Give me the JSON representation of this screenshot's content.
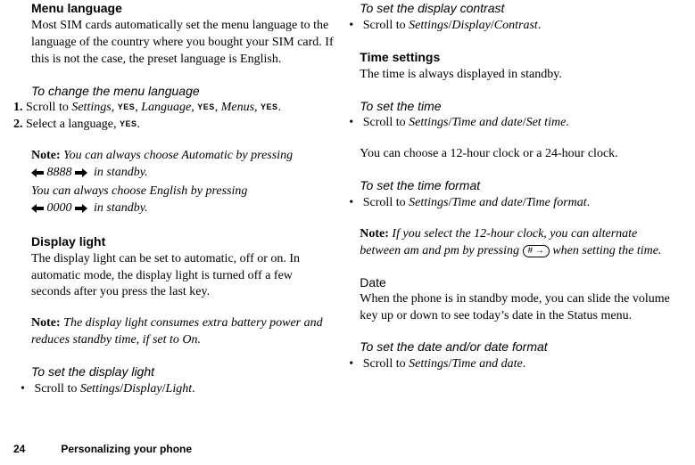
{
  "left": {
    "h_menu_language": "Menu language",
    "p_menu_language": "Most SIM cards automatically set the menu language to the language of the country where you bought your SIM card. If this is not the case, the preset language is English.",
    "h_change_menu_lang": "To change the menu language",
    "steps": {
      "s1_a": "Scroll to ",
      "s1_settings": "Settings",
      "s1_c1": ", ",
      "s1_c2": ", ",
      "s1_language": "Language",
      "s1_c3": ", ",
      "s1_c4": ", ",
      "s1_menus": "Menus",
      "s1_c5": ", ",
      "s1_end": ".",
      "s2_a": "Select a language, ",
      "s2_end": "."
    },
    "yes_label": "YES",
    "note_label": "Note:",
    "note1_a": "You can always choose Automatic by pressing",
    "note1_code": "8888",
    "note1_b": "in standby.",
    "note1_c": "You can always choose English by pressing",
    "note1_code2": "0000",
    "note1_d": "in standby.",
    "h_display_light": "Display light",
    "p_display_light": "The display light can be set to automatic, off or on. In automatic mode, the display light is turned off a few seconds after you press the last key.",
    "note2": "The display light consumes extra battery power and reduces standby time, if set to On.",
    "h_set_display_light": "To set the display light",
    "bul_sdl_a": "Scroll to ",
    "bul_sdl_path1": "Settings",
    "bul_sdl_sep": "/",
    "bul_sdl_path2": "Display",
    "bul_sdl_path3": "Light",
    "bul_sdl_end": "."
  },
  "right": {
    "h_set_display_contrast": "To set the display contrast",
    "bul_sdc_a": "Scroll to ",
    "bul_sdc_p1": "Settings",
    "sep": "/",
    "bul_sdc_p2": "Display",
    "bul_sdc_p3": "Contrast",
    "end": ".",
    "h_time_settings": "Time settings",
    "p_time_settings": "The time is always displayed in standby.",
    "h_set_time": "To set the time",
    "bul_st_a": "Scroll to ",
    "bul_st_p1": "Settings",
    "bul_st_p2": "Time and date",
    "bul_st_p3": "Set time",
    "p_clock_choice": "You can choose a 12-hour clock or a 24-hour clock.",
    "h_set_time_format": "To set the time format",
    "bul_stf_a": "Scroll to ",
    "bul_stf_p1": "Settings",
    "bul_stf_p2": "Time and date",
    "bul_stf_p3": "Time format",
    "note_label": "Note:",
    "note3_a": "If you select the 12-hour clock, you can alternate between am and pm by pressing ",
    "note3_b": " when setting the time.",
    "hash_key": "# →",
    "h_date": "Date",
    "p_date": "When the phone is in standby mode, you can slide the volume key up or down to see today’s date in the Status menu.",
    "h_set_date": "To set the date and/or date format",
    "bul_sd_a": "Scroll to ",
    "bul_sd_p1": "Settings",
    "bul_sd_p2": "Time and date"
  },
  "footer": {
    "page": "24",
    "title": "Personalizing your phone"
  }
}
